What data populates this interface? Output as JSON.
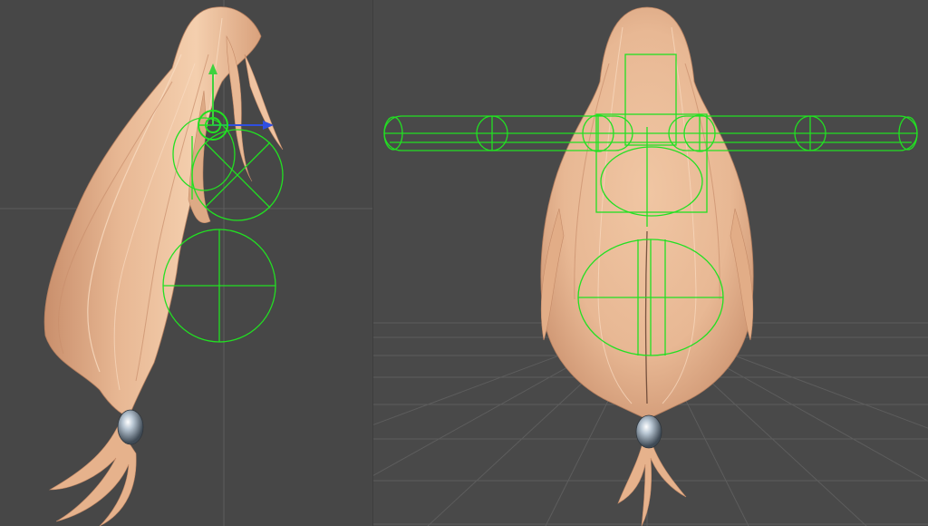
{
  "scene": {
    "viewports": [
      {
        "id": "side-view",
        "view": "side",
        "grid": "axis-lines",
        "gizmo": "move",
        "selected_bone": "head"
      },
      {
        "id": "back-view",
        "view": "back-perspective",
        "grid": "floor-grid"
      }
    ],
    "model": {
      "asset": "long-hair",
      "ornament": "hair-tie-bead"
    },
    "rig_bones": [
      "head",
      "neck",
      "chest",
      "spine",
      "upper-arm-left",
      "upper-arm-right",
      "forearm-left",
      "forearm-right",
      "hand-left",
      "hand-right"
    ]
  },
  "colors": {
    "viewport_background": "#474747",
    "grid_line": "#5d5d5d",
    "axis_line": "#707070",
    "hair_base": "#e8b894",
    "hair_light": "#f4cfae",
    "hair_shadow": "#c98f6c",
    "hair_strand": "#f9dcc2",
    "bone_wire": "#22e022",
    "gizmo_y": "#3ed23e",
    "gizmo_x": "#2f4fe0",
    "ornament_metal": "#9aa9b8"
  }
}
